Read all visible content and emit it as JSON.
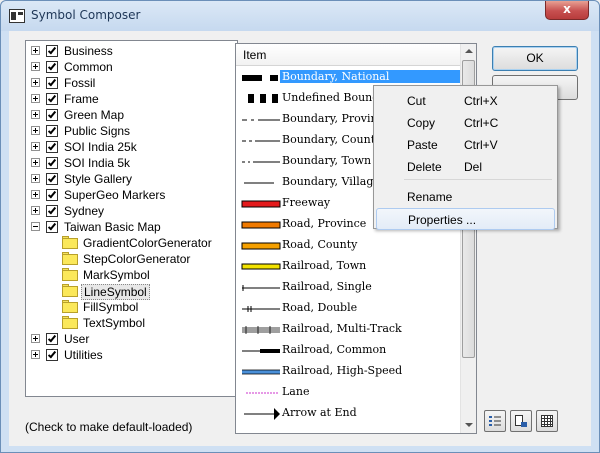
{
  "window": {
    "title": "Symbol Composer",
    "close_label": "x"
  },
  "tree": {
    "items": [
      {
        "label": "Business",
        "checked": true,
        "expander": "plus"
      },
      {
        "label": "Common",
        "checked": true,
        "expander": "plus"
      },
      {
        "label": "Fossil",
        "checked": true,
        "expander": "plus"
      },
      {
        "label": "Frame",
        "checked": true,
        "expander": "plus"
      },
      {
        "label": "Green Map",
        "checked": true,
        "expander": "plus"
      },
      {
        "label": "Public Signs",
        "checked": true,
        "expander": "plus"
      },
      {
        "label": "SOI India 25k",
        "checked": true,
        "expander": "plus"
      },
      {
        "label": "SOI India 5k",
        "checked": true,
        "expander": "plus"
      },
      {
        "label": "Style Gallery",
        "checked": true,
        "expander": "plus"
      },
      {
        "label": "SuperGeo Markers",
        "checked": true,
        "expander": "plus"
      },
      {
        "label": "Sydney",
        "checked": true,
        "expander": "plus"
      },
      {
        "label": "Taiwan Basic Map",
        "checked": true,
        "expander": "minus"
      }
    ],
    "children": [
      {
        "label": "GradientColorGenerator"
      },
      {
        "label": "StepColorGenerator"
      },
      {
        "label": "MarkSymbol"
      },
      {
        "label": "LineSymbol",
        "selected": true
      },
      {
        "label": "FillSymbol"
      },
      {
        "label": "TextSymbol"
      }
    ],
    "tail_items": [
      {
        "label": "User",
        "checked": true,
        "expander": "plus"
      },
      {
        "label": "Utilities",
        "checked": true,
        "expander": "plus"
      }
    ]
  },
  "hint": "(Check to make default-loaded)",
  "list": {
    "header": "Item",
    "rows": [
      {
        "name": "Boundary, National",
        "selected": true
      },
      {
        "name": "Undefined Boundary"
      },
      {
        "name": "Boundary, Province"
      },
      {
        "name": "Boundary, County"
      },
      {
        "name": "Boundary, Town"
      },
      {
        "name": "Boundary, Village"
      },
      {
        "name": "Freeway"
      },
      {
        "name": "Road, Province"
      },
      {
        "name": "Road, County"
      },
      {
        "name": "Railroad, Town"
      },
      {
        "name": "Railroad, Single"
      },
      {
        "name": "Road, Double"
      },
      {
        "name": "Railroad, Multi-Track"
      },
      {
        "name": "Railroad, Common"
      },
      {
        "name": "Railroad, High-Speed"
      },
      {
        "name": "Lane"
      },
      {
        "name": "Arrow at End"
      }
    ]
  },
  "buttons": {
    "ok": "OK"
  },
  "context_menu": {
    "items": [
      {
        "label": "Cut",
        "shortcut": "Ctrl+X"
      },
      {
        "label": "Copy",
        "shortcut": "Ctrl+C"
      },
      {
        "label": "Paste",
        "shortcut": "Ctrl+V"
      },
      {
        "label": "Delete",
        "shortcut": "Del"
      },
      {
        "label": "Rename",
        "shortcut": ""
      },
      {
        "label": "Properties ...",
        "shortcut": "",
        "hover": true
      }
    ]
  },
  "colors": {
    "selection": "#3399ff",
    "folder": "#fbe85a",
    "freeway": "#e31a1c",
    "road_province": "#f07a00",
    "road_county": "#f5a000",
    "railroad_town": "#f2e200",
    "lane": "#cc33cc",
    "highspeed": "#4a90d9"
  }
}
